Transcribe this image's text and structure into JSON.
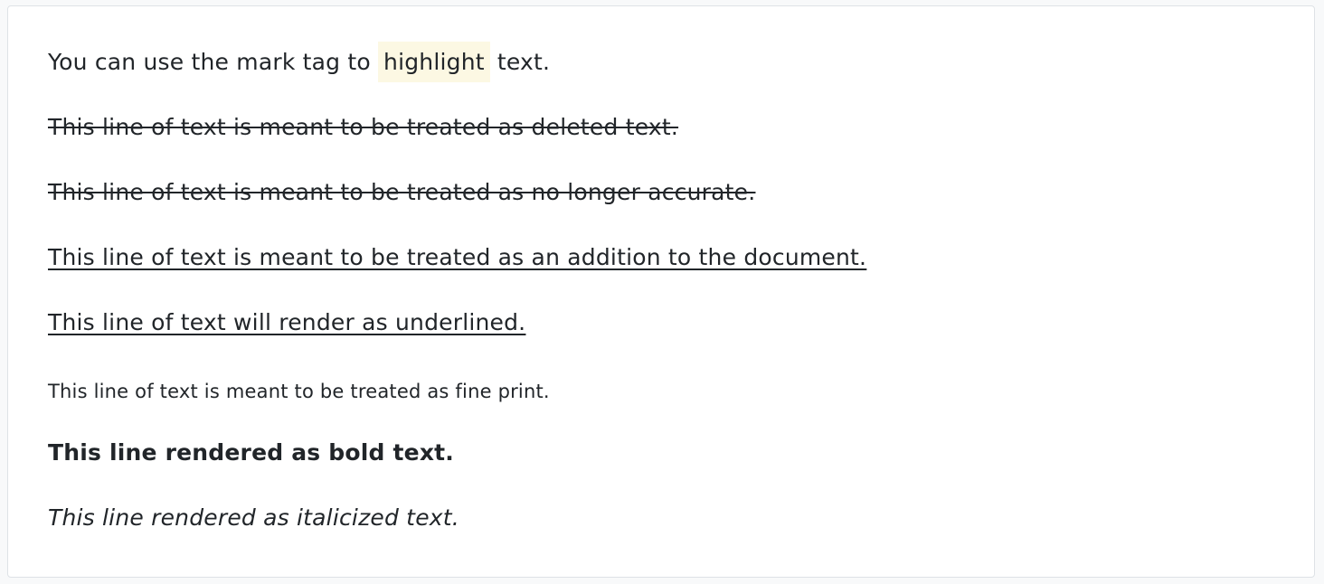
{
  "lines": {
    "mark_prefix": "You can use the mark tag to ",
    "mark_word": "highlight",
    "mark_suffix": " text.",
    "deleted": "This line of text is meant to be treated as deleted text.",
    "strikethrough": "This line of text is meant to be treated as no longer accurate.",
    "inserted": "This line of text is meant to be treated as an addition to the document.",
    "underlined": "This line of text will render as underlined.",
    "small": "This line of text is meant to be treated as fine print.",
    "bold": "This line rendered as bold text.",
    "italic": "This line rendered as italicized text."
  },
  "colors": {
    "text": "#212529",
    "mark_background": "#fcf8e3",
    "card_border": "#dee2e6",
    "card_background": "#ffffff"
  }
}
